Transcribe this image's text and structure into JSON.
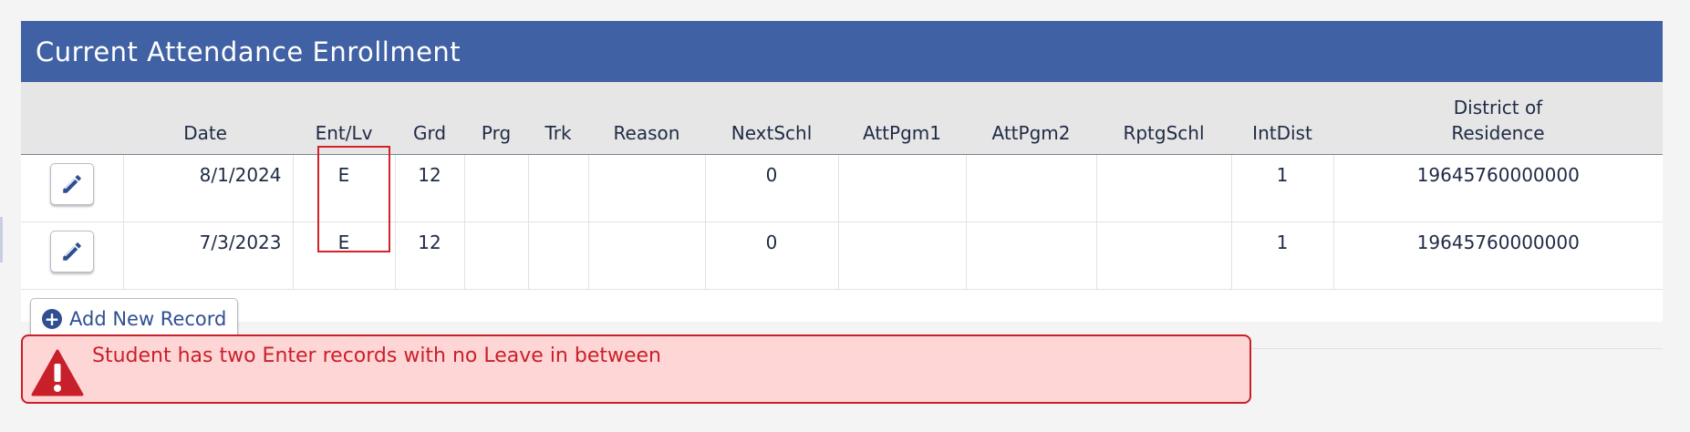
{
  "panel": {
    "title": "Current Attendance Enrollment"
  },
  "columns": {
    "edit": "",
    "date": "Date",
    "entlv": "Ent/Lv",
    "grd": "Grd",
    "prg": "Prg",
    "trk": "Trk",
    "reason": "Reason",
    "nextschl": "NextSchl",
    "attpgm1": "AttPgm1",
    "attpgm2": "AttPgm2",
    "rptgschl": "RptgSchl",
    "intdist": "IntDist",
    "district_line1": "District of",
    "district_line2": "Residence"
  },
  "rows": [
    {
      "date": "8/1/2024",
      "entlv": "E",
      "grd": "12",
      "prg": "",
      "trk": "",
      "reason": "",
      "nextschl": "0",
      "attpgm1": "",
      "attpgm2": "",
      "rptgschl": "",
      "intdist": "1",
      "district": "19645760000000"
    },
    {
      "date": "7/3/2023",
      "entlv": "E",
      "grd": "12",
      "prg": "",
      "trk": "",
      "reason": "",
      "nextschl": "0",
      "attpgm1": "",
      "attpgm2": "",
      "rptgschl": "",
      "intdist": "1",
      "district": "19645760000000"
    }
  ],
  "actions": {
    "add_label": "Add New Record"
  },
  "alert": {
    "message": "Student has two Enter records with no Leave in between"
  },
  "icons": {
    "edit": "pencil-icon",
    "add": "plus-circle-icon",
    "warning": "warning-triangle-icon"
  },
  "colors": {
    "header_bg": "#4061a4",
    "accent": "#2f4f92",
    "alert_bg": "#ffd6d6",
    "alert_border": "#c8202a",
    "highlight": "#d2232a"
  }
}
